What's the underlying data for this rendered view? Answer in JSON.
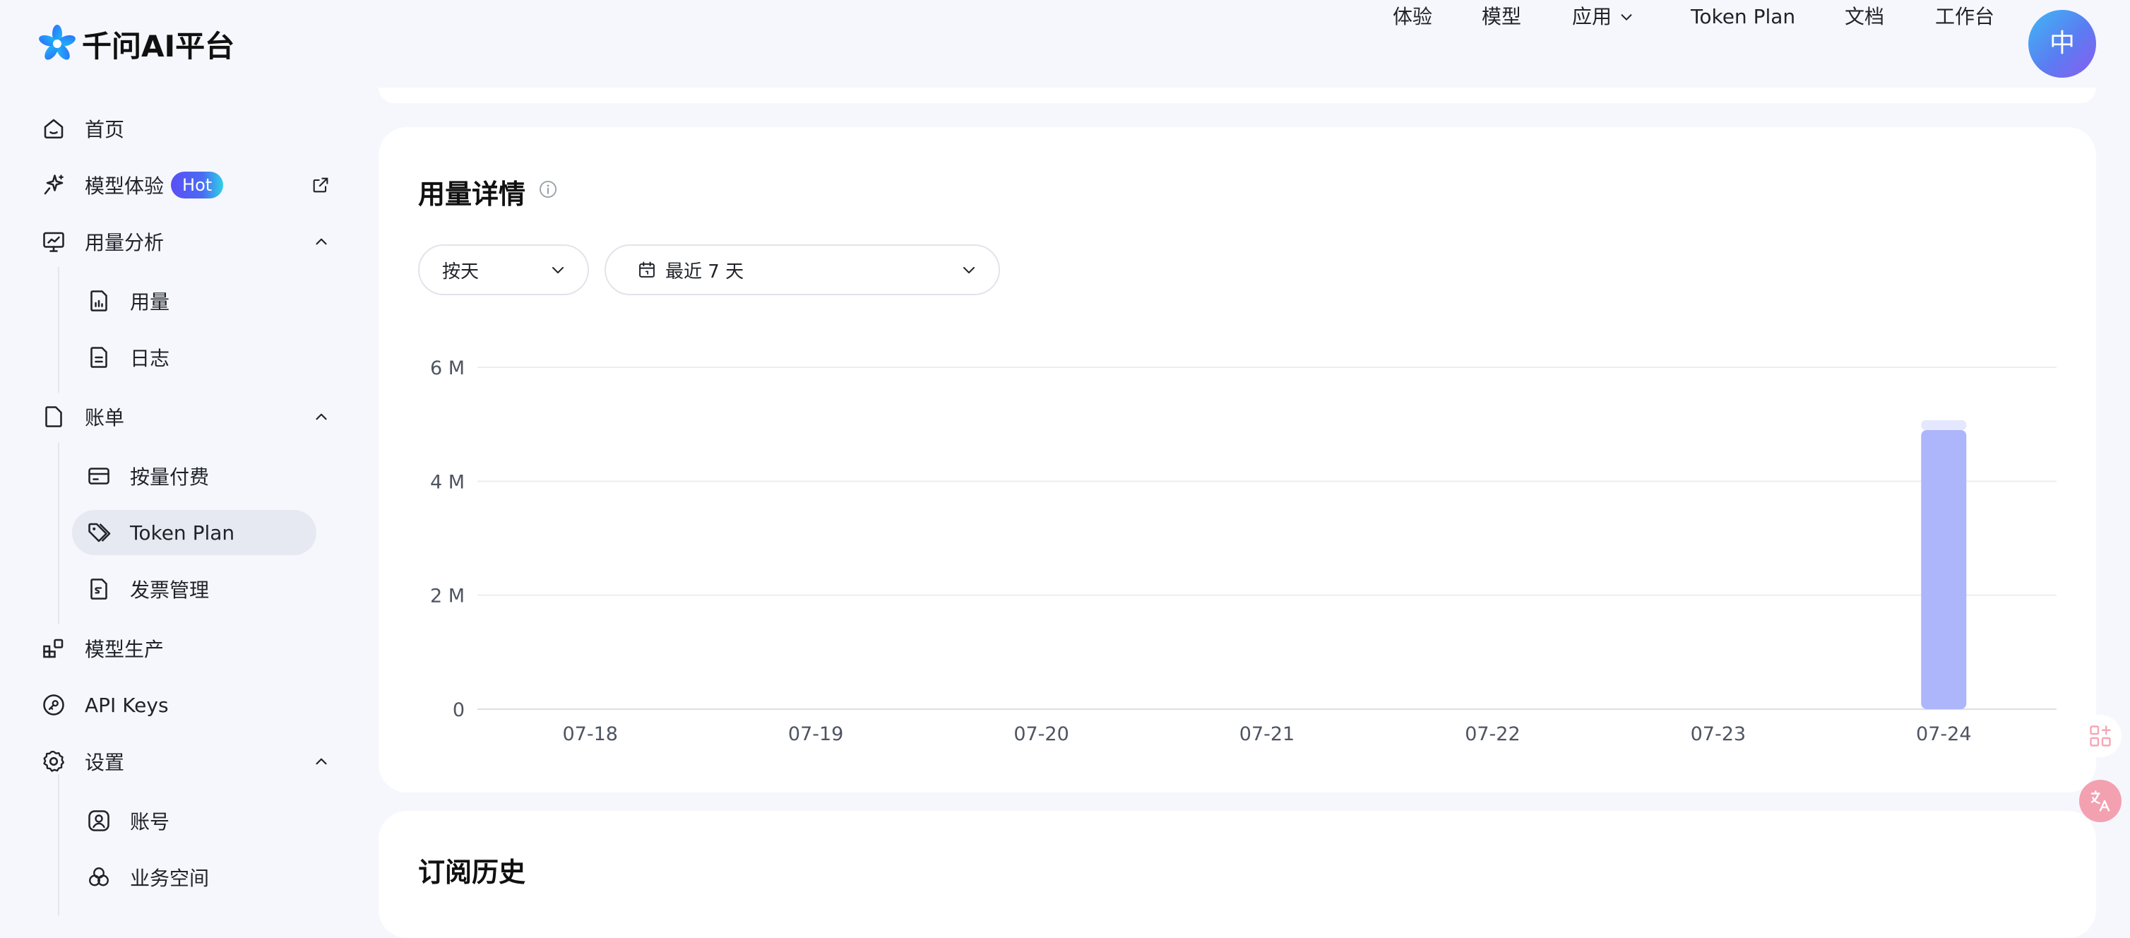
{
  "brand": {
    "name": "千问AI平台"
  },
  "top_nav": {
    "items": [
      {
        "label": "体验"
      },
      {
        "label": "模型"
      },
      {
        "label": "应用"
      },
      {
        "label": "Token Plan"
      },
      {
        "label": "文档"
      },
      {
        "label": "工作台"
      }
    ],
    "avatar_label": "中"
  },
  "sidebar": {
    "home": "首页",
    "model_experience": "模型体验",
    "hot_badge": "Hot",
    "usage_analysis": "用量分析",
    "usage": "用量",
    "logs": "日志",
    "billing": "账单",
    "pay_as_you_go": "按量付费",
    "token_plan": "Token Plan",
    "invoice": "发票管理",
    "model_production": "模型生产",
    "api_keys": "API Keys",
    "settings": "设置",
    "account": "账号",
    "workspace": "业务空间"
  },
  "usage_card": {
    "title": "用量详情",
    "granularity_select": "按天",
    "date_range_select": "最近 7 天"
  },
  "chart_data": {
    "type": "bar",
    "categories": [
      "07-18",
      "07-19",
      "07-20",
      "07-21",
      "07-22",
      "07-23",
      "07-24"
    ],
    "series": [
      {
        "values": [
          0,
          0,
          0,
          0,
          0,
          0,
          4.9
        ]
      },
      {
        "values": [
          0,
          0,
          0,
          0,
          0,
          0,
          0.17
        ]
      }
    ],
    "unit": "M",
    "yticks": [
      {
        "value": 0,
        "label": "0"
      },
      {
        "value": 2,
        "label": "2 M"
      },
      {
        "value": 4,
        "label": "4 M"
      },
      {
        "value": 6,
        "label": "6 M"
      }
    ],
    "ylim": [
      0,
      6
    ],
    "grid": true,
    "colors": [
      "#adb5fb",
      "#e4e7fd"
    ]
  },
  "history_card": {
    "title": "订阅历史"
  }
}
